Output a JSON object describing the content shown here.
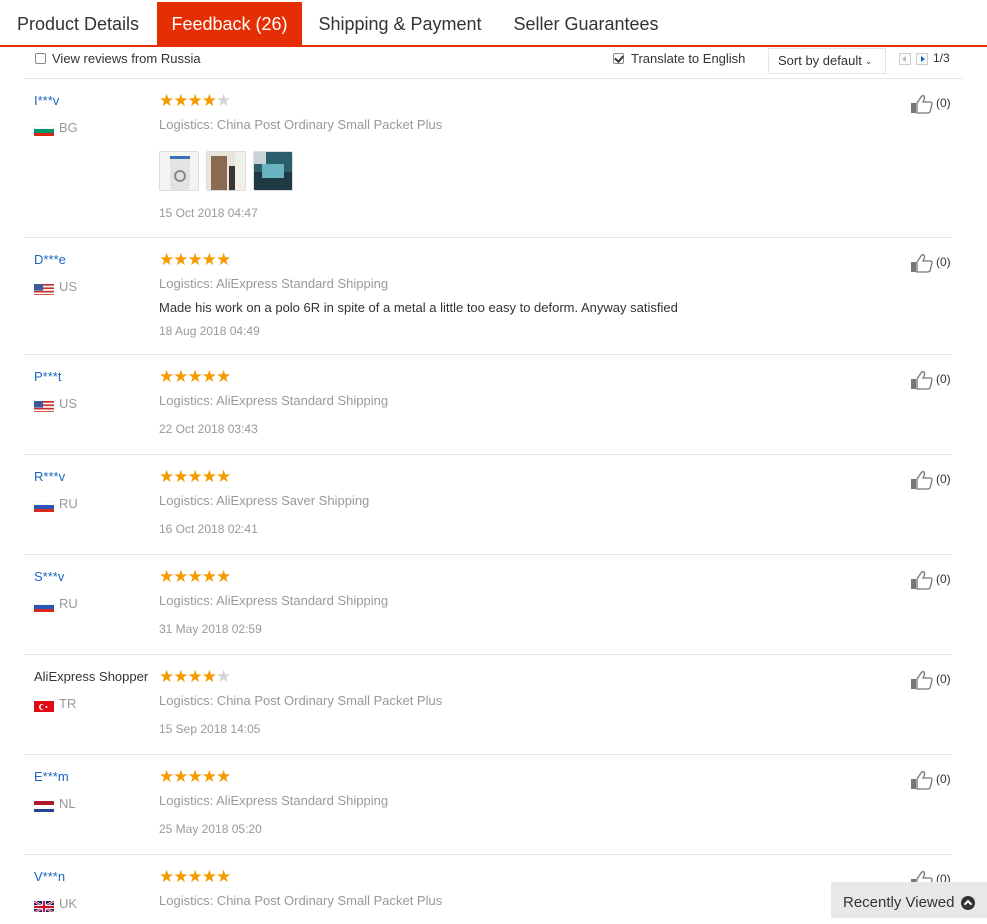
{
  "tabs": [
    {
      "label": "Product Details"
    },
    {
      "label": "Feedback (26)"
    },
    {
      "label": "Shipping & Payment"
    },
    {
      "label": "Seller Guarantees"
    }
  ],
  "toolbar": {
    "russia_label": "View reviews from Russia",
    "russia_checked": false,
    "translate_label": "Translate to English",
    "translate_checked": true,
    "sort_label": "Sort by default",
    "page": "1/3"
  },
  "reviews": [
    {
      "user": "I***v",
      "country": "BG",
      "rating": 4,
      "logistics": "Logistics: China Post Ordinary Small Packet Plus",
      "text": "",
      "date": "15 Oct 2018 04:47",
      "likes": "(0)",
      "photos": 3
    },
    {
      "user": "D***e",
      "country": "US",
      "rating": 5,
      "logistics": "Logistics: AliExpress Standard Shipping",
      "text": "Made his work on a polo 6R in spite of a metal a little too easy to deform. Anyway satisfied",
      "date": "18 Aug 2018 04:49",
      "likes": "(0)"
    },
    {
      "user": "P***t",
      "country": "US",
      "rating": 5,
      "logistics": "Logistics: AliExpress Standard Shipping",
      "text": "",
      "date": "22 Oct 2018 03:43",
      "likes": "(0)"
    },
    {
      "user": "R***v",
      "country": "RU",
      "rating": 5,
      "logistics": "Logistics: AliExpress Saver Shipping",
      "text": "",
      "date": "16 Oct 2018 02:41",
      "likes": "(0)"
    },
    {
      "user": "S***v",
      "country": "RU",
      "rating": 5,
      "logistics": "Logistics: AliExpress Standard Shipping",
      "text": "",
      "date": "31 May 2018 02:59",
      "likes": "(0)"
    },
    {
      "user": "AliExpress Shopper",
      "country": "TR",
      "rating": 4,
      "logistics": "Logistics: China Post Ordinary Small Packet Plus",
      "text": "",
      "date": "15 Sep 2018 14:05",
      "likes": "(0)"
    },
    {
      "user": "E***m",
      "country": "NL",
      "rating": 5,
      "logistics": "Logistics: AliExpress Standard Shipping",
      "text": "",
      "date": "25 May 2018 05:20",
      "likes": "(0)"
    },
    {
      "user": "V***n",
      "country": "UK",
      "rating": 5,
      "logistics": "Logistics: China Post Ordinary Small Packet Plus",
      "text": "",
      "date": "",
      "likes": "(0)"
    }
  ],
  "recently_viewed": {
    "label": "Recently Viewed"
  },
  "colors": {
    "accent": "#e62e04",
    "star": "#f69a00",
    "link": "#1a66c0"
  }
}
